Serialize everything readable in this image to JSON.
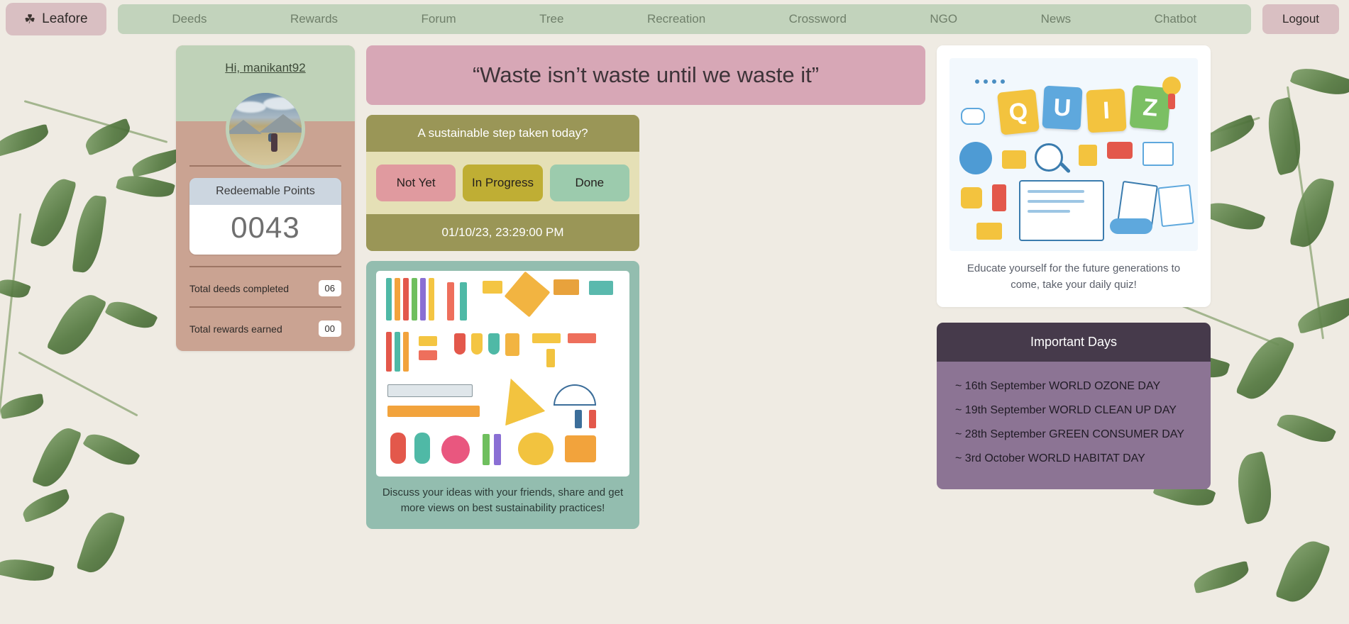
{
  "brand": {
    "name": "Leafore",
    "icon": "leaf-icon"
  },
  "nav": {
    "items": [
      {
        "label": "Deeds"
      },
      {
        "label": "Rewards"
      },
      {
        "label": "Forum"
      },
      {
        "label": "Tree"
      },
      {
        "label": "Recreation"
      },
      {
        "label": "Crossword"
      },
      {
        "label": "NGO"
      },
      {
        "label": "News"
      },
      {
        "label": "Chatbot"
      }
    ],
    "logout_label": "Logout"
  },
  "profile": {
    "greeting": "Hi, manikant92",
    "avatar_alt": "hiker-photo",
    "points_label": "Redeemable Points",
    "points_value": "0043",
    "stats": [
      {
        "label": "Total deeds completed",
        "value": "06"
      },
      {
        "label": "Total rewards earned",
        "value": "00"
      }
    ]
  },
  "quote": {
    "text": "“Waste isn’t waste until we waste it”"
  },
  "step_card": {
    "title": "A sustainable step taken today?",
    "buttons": [
      {
        "label": "Not Yet",
        "color": "#e09a9f"
      },
      {
        "label": "In Progress",
        "color": "#bfae34"
      },
      {
        "label": "Done",
        "color": "#9ccbad"
      }
    ],
    "timestamp": "01/10/23, 23:29:00 PM"
  },
  "forum_card": {
    "image_alt": "stationery-supplies-illustration",
    "caption": "Discuss your ideas with your friends, share and get more views on best sustainability practices!"
  },
  "quiz_card": {
    "image_alt": "quiz-illustration",
    "tiles": [
      "Q",
      "U",
      "I",
      "Z"
    ],
    "caption": "Educate yourself for the future generations to come, take your daily quiz!"
  },
  "important_days": {
    "title": "Important Days",
    "items": [
      "~ 16th September WORLD OZONE DAY",
      "~ 19th September WORLD CLEAN UP DAY",
      "~ 28th September GREEN CONSUMER DAY",
      "~ 3rd October WORLD HABITAT DAY"
    ]
  },
  "colors": {
    "page_bg": "#efebe3",
    "nav_bg": "#c2d3bc",
    "brand_btn": "#d9bfc2",
    "quote_bg": "#d7a7b6",
    "step_head": "#9a9657",
    "step_body": "#e5e0b6",
    "forum_bg": "#93bdaf",
    "days_head": "#463a4b",
    "days_body": "#8c7494",
    "profile_top": "#bfd2b8",
    "profile_body": "#caa392"
  }
}
